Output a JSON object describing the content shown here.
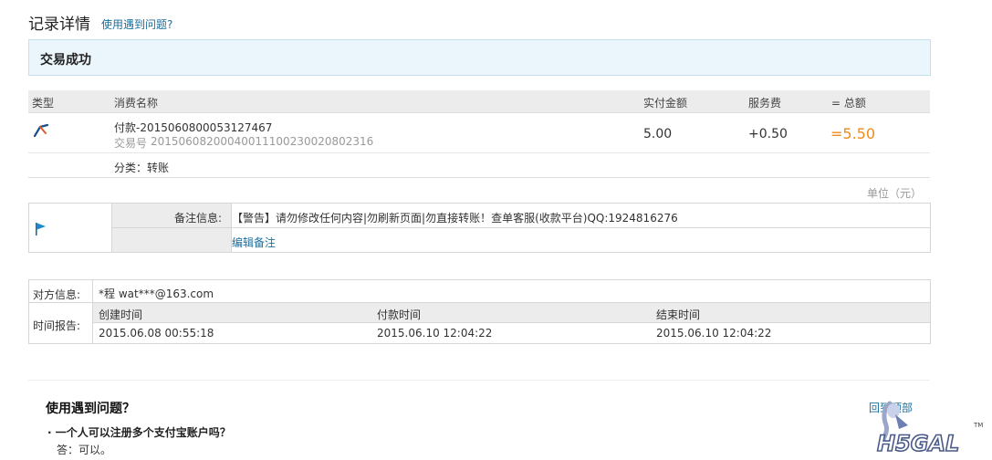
{
  "header": {
    "title": "记录详情",
    "help_link": "使用遇到问题?"
  },
  "status": "交易成功",
  "transaction": {
    "columns": [
      "类型",
      "消费名称",
      "实付金额",
      "服务费",
      "= 总额"
    ],
    "name": "付款-2015060800053127467",
    "trade_no_label": "交易号",
    "trade_no": "20150608200040011100230020802316",
    "amount": "5.00",
    "fee": "+0.50",
    "total": "=5.50",
    "category": "分类：转账",
    "unit": "单位（元）"
  },
  "memo": {
    "label": "备注信息:",
    "text": "【警告】请勿修改任何内容|勿刷新页面|勿直接转账！查单客服(收款平台)QQ:1924816276",
    "edit_link": "编辑备注"
  },
  "counterparty": {
    "label": "对方信息:",
    "value": "*程 wat***@163.com",
    "time_label": "时间报告:",
    "time_headers": [
      "创建时间",
      "付款时间",
      "结束时间"
    ],
    "times": [
      "2015.06.08 00:55:18",
      "2015.06.10 12:04:22",
      "2015.06.10 12:04:22"
    ]
  },
  "help": {
    "title": "使用遇到问题？",
    "back_to_top": "回到顶部",
    "question": "· 一个人可以注册多个支付宝账户吗？",
    "answer": "答：可以。"
  },
  "watermark": {
    "text": "H5GAL",
    "mark": "TM"
  },
  "colors": {
    "accent_link": "#1a6f9e",
    "total_orange": "#f08a1c",
    "status_bg": "#eaf5fc"
  }
}
